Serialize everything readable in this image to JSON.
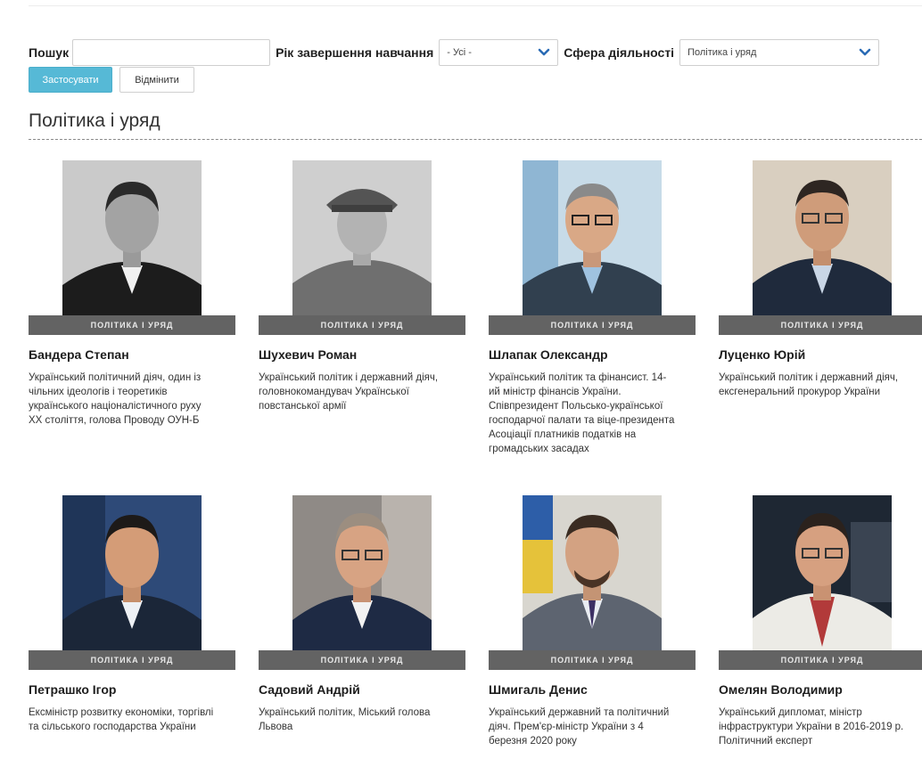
{
  "filters": {
    "search_label": "Пошук",
    "search_value": "",
    "year_label": "Рік завершення навчання",
    "year_selected": "- Усі -",
    "sphere_label": "Сфера діяльності",
    "sphere_selected": "Політика і уряд",
    "apply_label": "Застосувати",
    "cancel_label": "Відмінити"
  },
  "section_title": "Політика і уряд",
  "colors": {
    "accent": "#56b9d6",
    "tag_bg": "#636363"
  },
  "people": [
    {
      "tag": "ПОЛІТИКА І УРЯД",
      "name": "Бандера Степан",
      "desc": "Український політичний діяч, один із чільних ідеологів і теоретиків українського націоналістичного руху XX століття, голова Проводу ОУН-Б"
    },
    {
      "tag": "ПОЛІТИКА І УРЯД",
      "name": "Шухевич Роман",
      "desc": "Український політик і державний діяч, головнокомандувач Української повстанської армії"
    },
    {
      "tag": "ПОЛІТИКА І УРЯД",
      "name": "Шлапак Олександр",
      "desc": "Український політик та фінансист. 14-ий міністр фінансів України. Співпрезидент Польсько-української господарчої палати та віце-президента Асоціації платників податків на громадських засадах"
    },
    {
      "tag": "ПОЛІТИКА І УРЯД",
      "name": "Луценко Юрій",
      "desc": "Український політик і державний діяч, ексгенеральний прокурор України"
    },
    {
      "tag": "ПОЛІТИКА І УРЯД",
      "name": "Петрашко Ігор",
      "desc": "Ексміністр розвитку економіки, торгівлі та сільського господарства України"
    },
    {
      "tag": "ПОЛІТИКА І УРЯД",
      "name": "Садовий Андрій",
      "desc": "Український політик, Міський голова Львова"
    },
    {
      "tag": "ПОЛІТИКА І УРЯД",
      "name": "Шмигаль Денис",
      "desc": "Український державний та політичний діяч. Прем'єр-міністр України з 4 березня 2020 року"
    },
    {
      "tag": "ПОЛІТИКА І УРЯД",
      "name": "Омелян Володимир",
      "desc": "Український дипломат, міністр інфраструктури України в 2016-2019 р. Політичний експерт"
    }
  ]
}
